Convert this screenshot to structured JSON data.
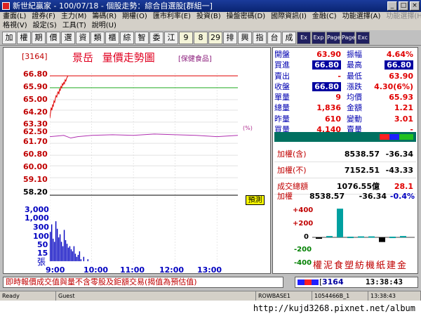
{
  "window": {
    "title": "新世紀贏家 - 100/07/18 - 個股走勢：綜合自選股[群組一]",
    "controls": [
      "_",
      "□",
      "×"
    ]
  },
  "menu": {
    "row1": [
      "畫面(L)",
      "證券(F)",
      "主力(M)",
      "籌碼(R)",
      "期權(O)",
      "匯市利率(E)",
      "投資(B)",
      "操盤密碼(D)",
      "國際資訊(I)",
      "金融(C)",
      "功能選擇(A)",
      "功能選擇(H)"
    ],
    "row2": [
      "格視(V)",
      "設定(S)",
      "工具(T)",
      "說明(U)"
    ]
  },
  "toolbar": {
    "buttons": [
      "加",
      "權",
      "期",
      "價",
      "選",
      "資",
      "類",
      "櫃",
      "綜",
      "智",
      "委",
      "江",
      "9",
      "8",
      "29",
      "排",
      "興",
      "指",
      "台",
      "成",
      "Ex",
      "Exp",
      "Page",
      "Page",
      "Exc"
    ]
  },
  "main": {
    "code": "[3164]",
    "name": "景岳",
    "chart_type_label": "量價走勢圖",
    "category": "[保健食品]",
    "adjust_tag": "預測",
    "pct_tag": "(%)",
    "volume_unit": "張"
  },
  "chart_data": {
    "type": "line",
    "y_price_ticks": [
      "66.80",
      "65.90",
      "65.00",
      "64.20",
      "63.30",
      "62.50",
      "61.70",
      "60.80",
      "60.00",
      "59.10",
      "58.20"
    ],
    "y_volume_ticks": [
      "3,000",
      "1,000",
      "300",
      "100",
      "50",
      "15"
    ],
    "x_ticks": [
      "9:00",
      "10:00",
      "11:00",
      "12:00",
      "13:00"
    ],
    "ylim": [
      58.2,
      66.8
    ],
    "reference_price": 62.5,
    "limit_up": 66.8,
    "avg_line": 62.25,
    "price_series": {
      "x_minutes": [
        0,
        1,
        2,
        3,
        4,
        5,
        6,
        7,
        8,
        9,
        10,
        11,
        12,
        13,
        14,
        15,
        16,
        17,
        18,
        19,
        20,
        21,
        22,
        23,
        24,
        25,
        26,
        27
      ],
      "values": [
        63.6,
        64.0,
        64.4,
        64.2,
        64.6,
        64.5,
        64.9,
        64.8,
        65.1,
        65.3,
        65.2,
        65.5,
        65.6,
        65.4,
        65.8,
        65.7,
        66.0,
        65.9,
        66.2,
        66.1,
        66.3,
        66.2,
        66.5,
        66.4,
        66.6,
        66.7,
        66.8,
        66.8
      ]
    },
    "avg_series": {
      "x_minutes": [
        0,
        10,
        20,
        30,
        40,
        60,
        90,
        120,
        150,
        180,
        210,
        240,
        270
      ],
      "values": [
        62.2,
        62.25,
        62.3,
        62.1,
        62.2,
        62.3,
        62.35,
        62.3,
        62.4,
        62.35,
        62.3,
        62.2,
        62.3
      ]
    },
    "volume_series": {
      "x_minutes": [
        0,
        2,
        4,
        6,
        8,
        10,
        12,
        14,
        16,
        18,
        20,
        22,
        24,
        26,
        28,
        30,
        32,
        34,
        36,
        38,
        40,
        42,
        44,
        46,
        48,
        50,
        52,
        54,
        56,
        58,
        60
      ],
      "values": [
        150,
        300,
        80,
        60,
        400,
        200,
        90,
        120,
        60,
        40,
        180,
        70,
        50,
        35,
        40,
        30,
        25,
        40,
        20,
        15,
        18,
        25,
        12,
        10,
        15,
        8,
        10,
        12,
        6,
        8,
        5
      ]
    }
  },
  "quote": {
    "rows": [
      {
        "l1": "開盤",
        "v1": "63.90",
        "l2": "振幅",
        "v2": "4.64%"
      },
      {
        "l1": "買進",
        "v1": "66.80",
        "l2": "最高",
        "v2": "66.80"
      },
      {
        "l1": "賣出",
        "v1": "-",
        "l2": "最低",
        "v2": "63.90"
      },
      {
        "l1": "收盤",
        "v1": "66.80",
        "l2": "漲跌",
        "v2": "4.30(6%)"
      },
      {
        "l1": "單量",
        "v1": "9",
        "l2": "均價",
        "v2": "65.93"
      },
      {
        "l1": "總量",
        "v1": "1,836",
        "l2": "金額",
        "v2": "1.21"
      },
      {
        "l1": "昨量",
        "v1": "610",
        "l2": "變動",
        "v2": "3.01"
      },
      {
        "l1": "買量",
        "v1": "4,140",
        "l2": "賣量",
        "v2": "-"
      }
    ]
  },
  "index": {
    "rows": [
      {
        "label": "加權(含)",
        "value": "8538.57",
        "change": "-36.34"
      },
      {
        "label": "加權(不)",
        "value": "7152.51",
        "change": "-43.33"
      },
      {
        "label": "成交總額",
        "value": "1076.55億",
        "change": "28.1"
      }
    ]
  },
  "sector": {
    "label": "加權",
    "value": "8538.57",
    "change": "-36.34",
    "pct": "-0.4%",
    "y_ticks": [
      "+400",
      "+200",
      "0",
      "-200",
      "-400"
    ],
    "categories": [
      "權",
      "泥",
      "食",
      "塑",
      "紡",
      "機",
      "紙",
      "建",
      "金"
    ],
    "values": [
      -20,
      20,
      430,
      10,
      15,
      15,
      -70,
      10,
      20
    ]
  },
  "status": {
    "message": "即時報價成交值與量不含零股及鉅額交易(揭值為預估值)",
    "code_input": "3164",
    "clock": "13:38:43"
  },
  "statusbar": {
    "cells": [
      "Ready",
      "Guest",
      "ROWBASE1",
      "1054466B_1",
      "13:38:43"
    ]
  },
  "watermark": "http://kujd3268.pixnet.net/album",
  "colors": {
    "price_up": "#e00000",
    "limit_line": "#e00000",
    "avg_line": "#b030b0",
    "volume": "#0000c0",
    "ref_line": "#00a000"
  }
}
